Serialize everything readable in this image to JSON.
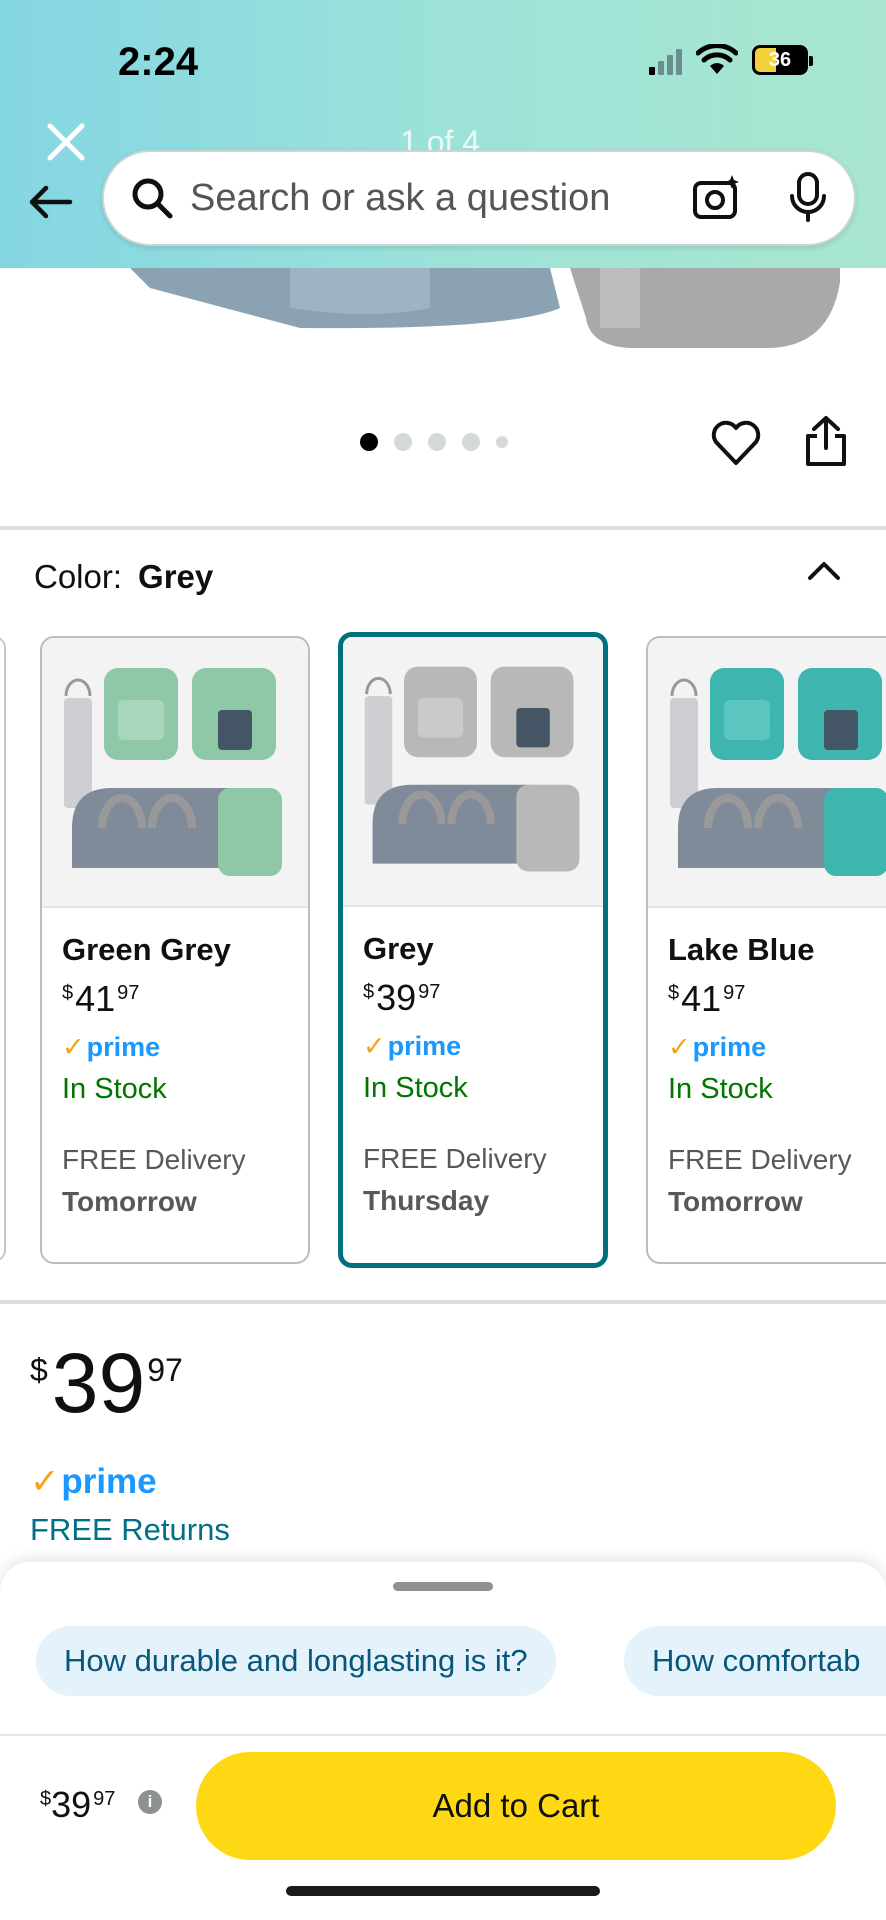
{
  "status_bar": {
    "time": "2:24",
    "battery": "36"
  },
  "header": {
    "page_count": "1 of 4",
    "search_placeholder": "Search or ask a question"
  },
  "image_carousel": {
    "dot_count": 5,
    "active_index": 0
  },
  "color_section": {
    "label": "Color:",
    "selected": "Grey",
    "swatches": [
      {
        "name": "Green Grey",
        "price_symbol": "$",
        "price_whole": "41",
        "price_cents": "97",
        "prime": "prime",
        "stock": "In Stock",
        "delivery_label": "FREE Delivery",
        "delivery_day": "Tomorrow",
        "accent": "#8fc8a6"
      },
      {
        "name": "Grey",
        "price_symbol": "$",
        "price_whole": "39",
        "price_cents": "97",
        "prime": "prime",
        "stock": "In Stock",
        "delivery_label": "FREE Delivery",
        "delivery_day": "Thursday",
        "accent": "#b8b8b8"
      },
      {
        "name": "Lake Blue",
        "price_symbol": "$",
        "price_whole": "41",
        "price_cents": "97",
        "prime": "prime",
        "stock": "In Stock",
        "delivery_label": "FREE Delivery",
        "delivery_day": "Tomorrow",
        "accent": "#3fb5b0"
      }
    ]
  },
  "price": {
    "symbol": "$",
    "whole": "39",
    "cents": "97",
    "prime": "prime",
    "returns": "FREE Returns"
  },
  "questions": [
    "How durable and longlasting is it?",
    "How comfortab"
  ],
  "footer": {
    "price_symbol": "$",
    "price_whole": "39",
    "price_cents": "97",
    "add_to_cart": "Add to Cart"
  },
  "colors": {
    "prime_blue": "#1a98ff",
    "prime_check": "#f7a21b",
    "in_stock": "#007600",
    "selected_border": "#00707f",
    "cart_button": "#ffd814",
    "link": "#007185"
  }
}
